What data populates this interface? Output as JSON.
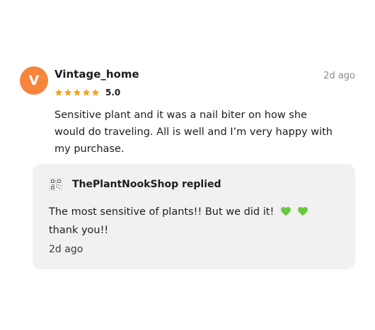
{
  "review": {
    "avatar_initial": "V",
    "avatar_color": "#f7853c",
    "username": "Vintage_home",
    "timestamp": "2d ago",
    "star_color": "#f1a41f",
    "star_count": 5,
    "rating": "5.0",
    "text": "Sensitive plant and it was a nail biter on how she would do traveling. All is well and I’m very happy with my purchase."
  },
  "reply": {
    "shop_logo_icon": "shop-logo-qr",
    "header": "ThePlantNookShop replied",
    "text": "The most sensitive of plants!! But we did it!",
    "emoji": [
      "green-heart-icon",
      "green-heart-icon"
    ],
    "emoji_color": "#6ac93f",
    "text_end": "thank you!!",
    "timestamp": "2d ago"
  }
}
